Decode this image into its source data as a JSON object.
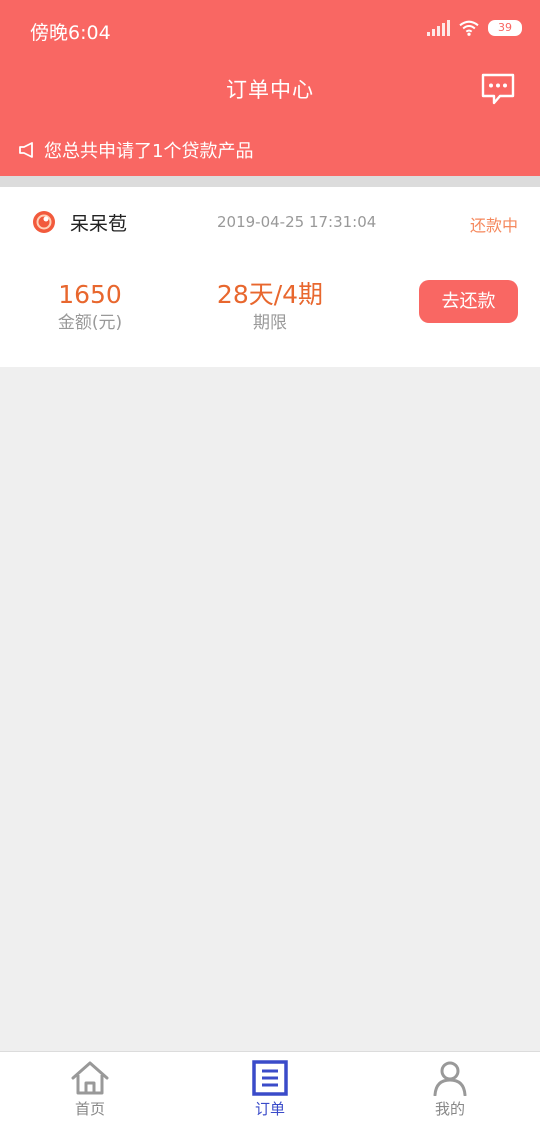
{
  "status_bar": {
    "time": "傍晚6:04",
    "battery": "39"
  },
  "header": {
    "title": "订单中心",
    "notice": "您总共申请了1个贷款产品"
  },
  "order": {
    "product_name": "呆呆苞",
    "date": "2019-04-25 17:31:04",
    "status": "还款中",
    "amount": "1650",
    "amount_label": "金额(元)",
    "term": "28天/4期",
    "term_label": "期限",
    "repay_button": "去还款"
  },
  "tabbar": {
    "items": [
      {
        "label": "首页",
        "icon": "home-icon"
      },
      {
        "label": "订单",
        "icon": "order-icon"
      },
      {
        "label": "我的",
        "icon": "profile-icon"
      }
    ],
    "active_index": 1
  },
  "colors": {
    "brand": "#f96763",
    "accent_orange": "#e8672e",
    "active_tab": "#3a4bc9"
  }
}
